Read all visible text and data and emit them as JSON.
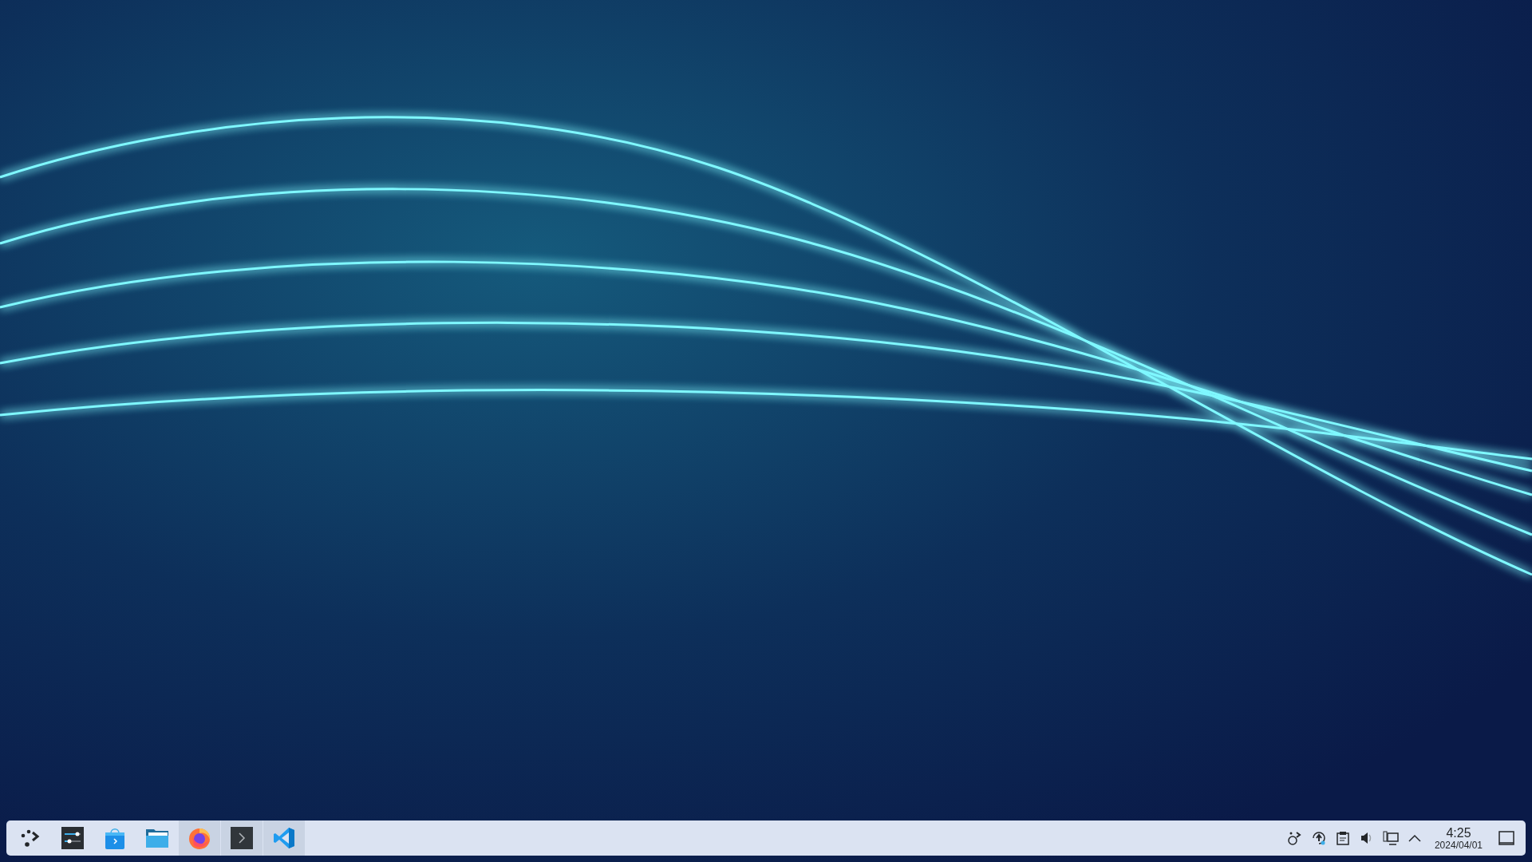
{
  "taskbar": {
    "tasks": [
      {
        "kind": "launcher",
        "running": false
      },
      {
        "kind": "settings",
        "running": false
      },
      {
        "kind": "store",
        "running": false
      },
      {
        "kind": "files",
        "running": false
      },
      {
        "kind": "browser",
        "running": true
      },
      {
        "kind": "terminal",
        "running": true
      },
      {
        "kind": "editor",
        "running": true
      }
    ],
    "tray": [
      {
        "kind": "network-share"
      },
      {
        "kind": "updates"
      },
      {
        "kind": "clipboard"
      },
      {
        "kind": "volume"
      },
      {
        "kind": "display"
      },
      {
        "kind": "expand"
      }
    ],
    "clock": {
      "time": "4:25",
      "date": "2024/04/01"
    }
  }
}
